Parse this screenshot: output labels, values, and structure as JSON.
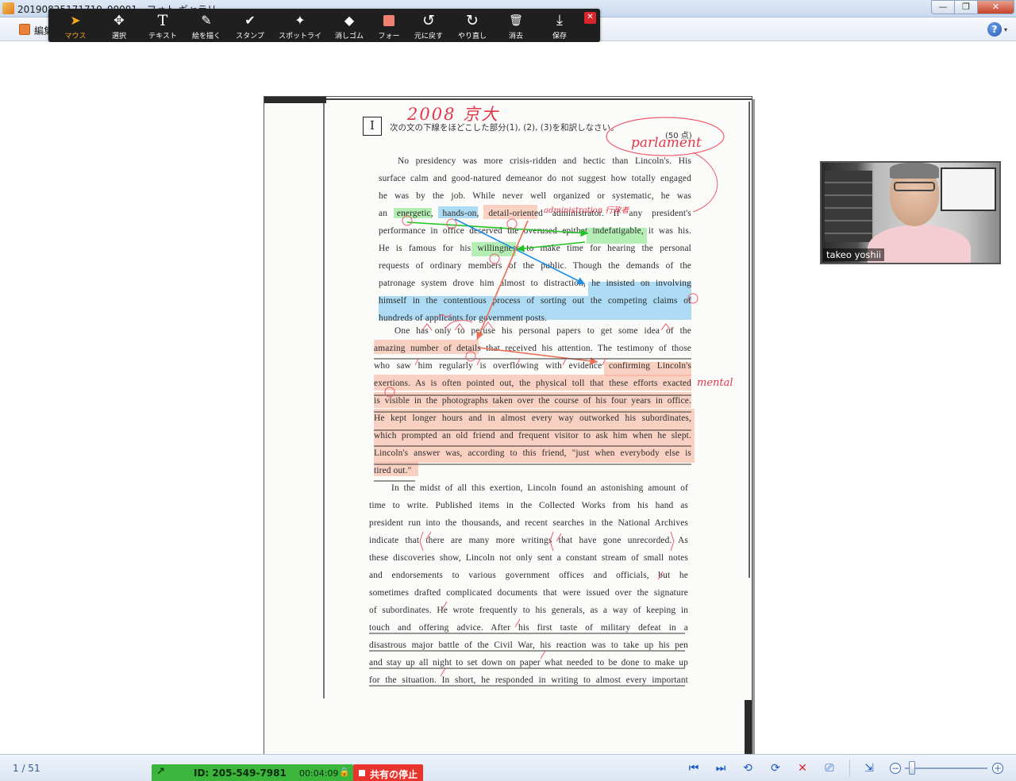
{
  "window": {
    "title": "20190825171719_00001 - フォト ギャラリー",
    "minimize": "—",
    "maximize": "❐",
    "close": "✕"
  },
  "menubar": {
    "edit_label": "編集",
    "help": "?",
    "help_arrow": "▾"
  },
  "annotation_toolbar": {
    "tools": [
      {
        "label": "マウス",
        "icon": "mouse-pointer-icon",
        "glyph": "➤"
      },
      {
        "label": "選択",
        "icon": "select-move-icon",
        "glyph": "✥"
      },
      {
        "label": "テキスト",
        "icon": "text-icon",
        "glyph": "T"
      },
      {
        "label": "絵を描く",
        "icon": "pen-icon",
        "glyph": "✎"
      },
      {
        "label": "スタンプ",
        "icon": "checkmark-stamp-icon",
        "glyph": "✔"
      },
      {
        "label": "スポットライ",
        "icon": "spotlight-wand-icon",
        "glyph": "✦"
      },
      {
        "label": "消しゴム",
        "icon": "eraser-icon",
        "glyph": "◆"
      },
      {
        "label": "フォー",
        "icon": "format-color-icon",
        "glyph": "■"
      },
      {
        "label": "元に戻す",
        "icon": "undo-icon",
        "glyph": "↺"
      },
      {
        "label": "やり直し",
        "icon": "redo-icon",
        "glyph": "↻"
      },
      {
        "label": "消去",
        "icon": "trash-icon",
        "glyph": "🗑"
      },
      {
        "label": "保存",
        "icon": "save-icon",
        "glyph": "⤓"
      }
    ],
    "active": "マウス",
    "close_glyph": "✕",
    "accent_color": "#f5a623",
    "format_color": "#f08070"
  },
  "document": {
    "question_number": "I",
    "instruction": "次の文の下線をほどこした部分(1), (2), (3)を和訳しなさい。",
    "points": "(50 点)",
    "paragraph1": [
      "No presidency was more crisis-ridden and hectic than Lincoln's.  His",
      "surface calm and good-natured demeanor do not suggest how totally engaged",
      "he was by the job.  While never well organized or systematic, he was",
      "an energetic, hands-on, detail-oriented administrator.  If any president's",
      "performance in office deserved the overused epithet indefatigable, it was his.",
      "He is famous for his willingness to make time for hearing the personal",
      "requests of ordinary members of the public.  Though the demands of the",
      "patronage system drove him almost to distraction, he insisted on involving",
      "himself in the contentious process of sorting out the competing claims of",
      "hundreds of applicants for government posts."
    ],
    "paragraph2": [
      "One has only to peruse his personal papers to get some idea of the",
      "amazing number of details that received his attention.  The testimony of those",
      "who saw him regularly is overflowing with evidence confirming Lincoln's",
      "exertions.  As is often pointed out, the physical toll that these efforts exacted",
      "is visible in the photographs taken over the course of his four years in office.",
      "He kept longer hours and in almost every way outworked his subordinates,",
      "which prompted an old friend and frequent visitor to ask him when he slept.",
      "Lincoln's answer was, according to this friend, \"just when everybody else is",
      "tired out.\""
    ],
    "paragraph3": [
      "In the midst of all this exertion, Lincoln found an astonishing amount of",
      "time to write.  Published items in the Collected Works from his hand as",
      "president run into the thousands, and recent searches in the National Archives",
      "indicate that there are many more writings that have gone unrecorded.  As",
      "these discoveries show, Lincoln not only sent a constant stream of small notes",
      "and endorsements to various government offices and officials, but he",
      "sometimes drafted complicated documents that were issued over the signature",
      "of subordinates.  He wrote frequently to his generals, as a way of keeping in",
      "touch and offering advice.  After his first taste of military defeat in a",
      "disastrous major battle of the Civil War, his reaction was to take up his pen",
      "and stay up all night to set down on paper what needed to be done to make up",
      "for the situation.  In short, he responded in writing to almost every important"
    ],
    "handwriting": {
      "title": "2008 京大",
      "word": "parlament",
      "mental": "mental",
      "admin": "administration 行政者"
    },
    "highlight_colors": {
      "green": "#7be37b",
      "blue": "#6fc1ef",
      "salmon": "#f6a88c",
      "ink": "#e2384a"
    }
  },
  "webcam": {
    "participant_name": "takeo yoshii"
  },
  "statusbar": {
    "page_counter": "1 / 51",
    "share_arrow": "↗",
    "meeting_id": "ID: 205-549-7981",
    "elapsed": "00:04:09",
    "lock": "🔒",
    "stop_share": "共有の停止",
    "nav": {
      "first": "⏮",
      "next": "⏭",
      "rotate_left": "⟲",
      "rotate_right": "⟳",
      "delete": "✕",
      "slideshow": "⎚",
      "fit": "⇲",
      "zoom_out": "−",
      "zoom_in": "+"
    },
    "zoom_level": 0.05
  }
}
